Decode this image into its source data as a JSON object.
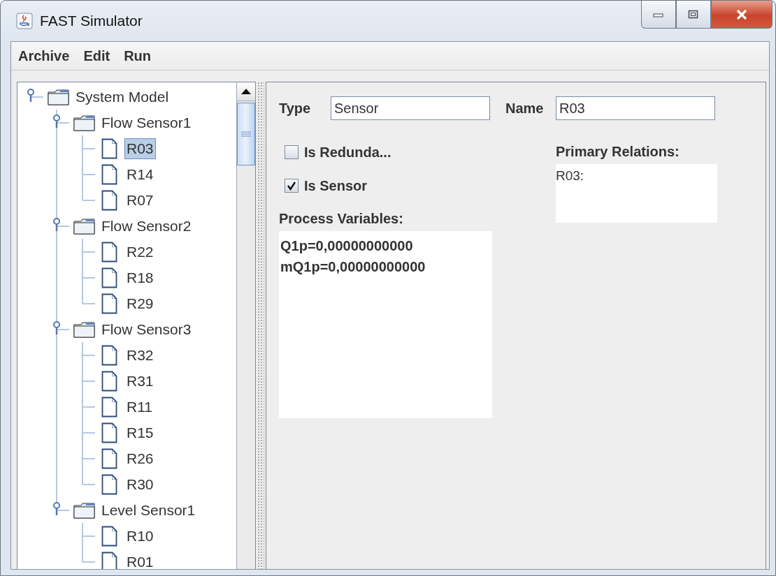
{
  "window": {
    "title": "FAST Simulator"
  },
  "menu": [
    "Archive",
    "Edit",
    "Run"
  ],
  "tree": [
    {
      "label": "System Model",
      "kind": "folder",
      "expanded": true,
      "selected": false,
      "children": [
        {
          "label": "Flow Sensor1",
          "kind": "folder",
          "expanded": true,
          "selected": false,
          "children": [
            {
              "label": "R03",
              "kind": "file",
              "selected": true
            },
            {
              "label": "R14",
              "kind": "file",
              "selected": false
            },
            {
              "label": "R07",
              "kind": "file",
              "selected": false
            }
          ]
        },
        {
          "label": "Flow Sensor2",
          "kind": "folder",
          "expanded": true,
          "selected": false,
          "children": [
            {
              "label": "R22",
              "kind": "file",
              "selected": false
            },
            {
              "label": "R18",
              "kind": "file",
              "selected": false
            },
            {
              "label": "R29",
              "kind": "file",
              "selected": false
            }
          ]
        },
        {
          "label": "Flow Sensor3",
          "kind": "folder",
          "expanded": true,
          "selected": false,
          "children": [
            {
              "label": "R32",
              "kind": "file",
              "selected": false
            },
            {
              "label": "R31",
              "kind": "file",
              "selected": false
            },
            {
              "label": "R11",
              "kind": "file",
              "selected": false
            },
            {
              "label": "R15",
              "kind": "file",
              "selected": false
            },
            {
              "label": "R26",
              "kind": "file",
              "selected": false
            },
            {
              "label": "R30",
              "kind": "file",
              "selected": false
            }
          ]
        },
        {
          "label": "Level Sensor1",
          "kind": "folder",
          "expanded": true,
          "selected": false,
          "children": [
            {
              "label": "R10",
              "kind": "file",
              "selected": false
            },
            {
              "label": "R01",
              "kind": "file",
              "selected": false
            }
          ]
        }
      ]
    }
  ],
  "form": {
    "type_label": "Type",
    "type_value": "Sensor",
    "name_label": "Name",
    "name_value": "R03"
  },
  "checkboxes": [
    {
      "label": "Is Redunda...",
      "checked": false
    },
    {
      "label": "Is Sensor",
      "checked": true
    }
  ],
  "process_variables": {
    "label": "Process Variables:",
    "lines": [
      "Q1p=0,00000000000",
      "mQ1p=0,00000000000"
    ]
  },
  "primary_relations": {
    "label": "Primary Relations:",
    "lines": [
      "R03:"
    ]
  }
}
